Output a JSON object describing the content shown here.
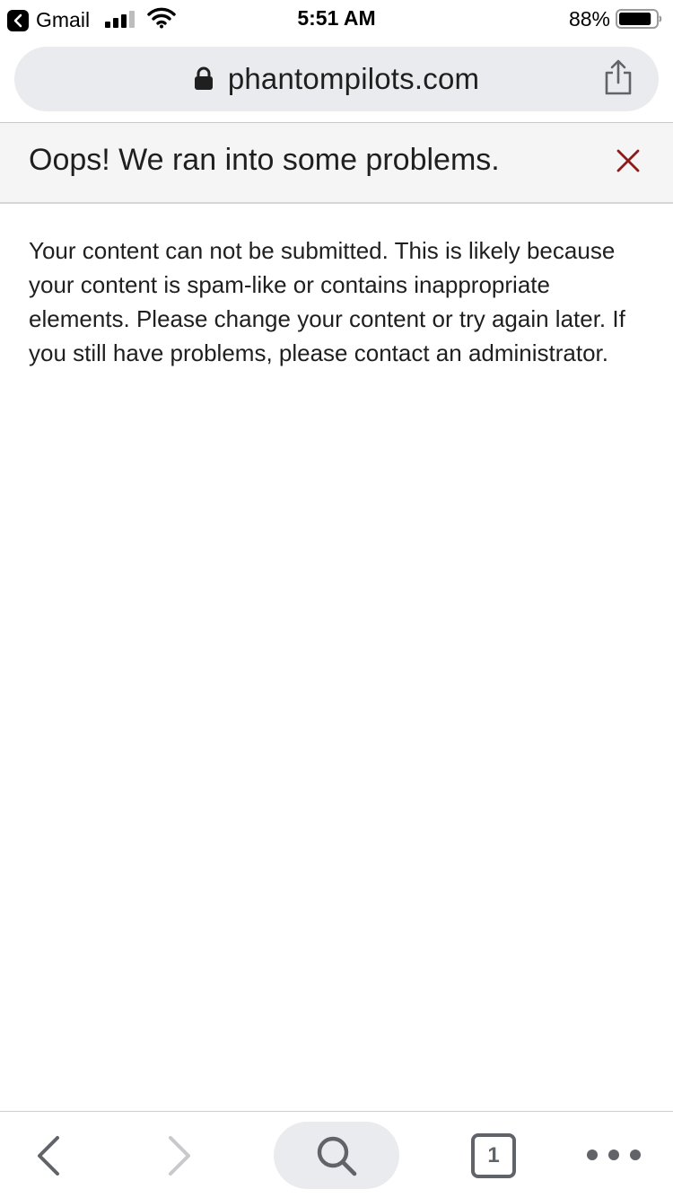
{
  "status_bar": {
    "back_app": "Gmail",
    "time": "5:51 AM",
    "battery": "88%",
    "battery_level": 0.88
  },
  "browser": {
    "url": "phantompilots.com",
    "tabs_count": "1"
  },
  "error": {
    "title": "Oops! We ran into some problems.",
    "message": "Your content can not be submitted. This is likely because your content is spam-like or contains inappropriate elements. Please change your content or try again later. If you still have problems, please contact an administrator."
  },
  "colors": {
    "close_icon": "#8b1a1a",
    "url_bar_bg": "#e9ebee",
    "error_header_bg": "#f5f5f5"
  },
  "icons": {
    "back_app": "chevron-left-icon",
    "lock": "lock-icon",
    "share": "share-icon",
    "close": "close-icon",
    "search": "search-icon"
  }
}
